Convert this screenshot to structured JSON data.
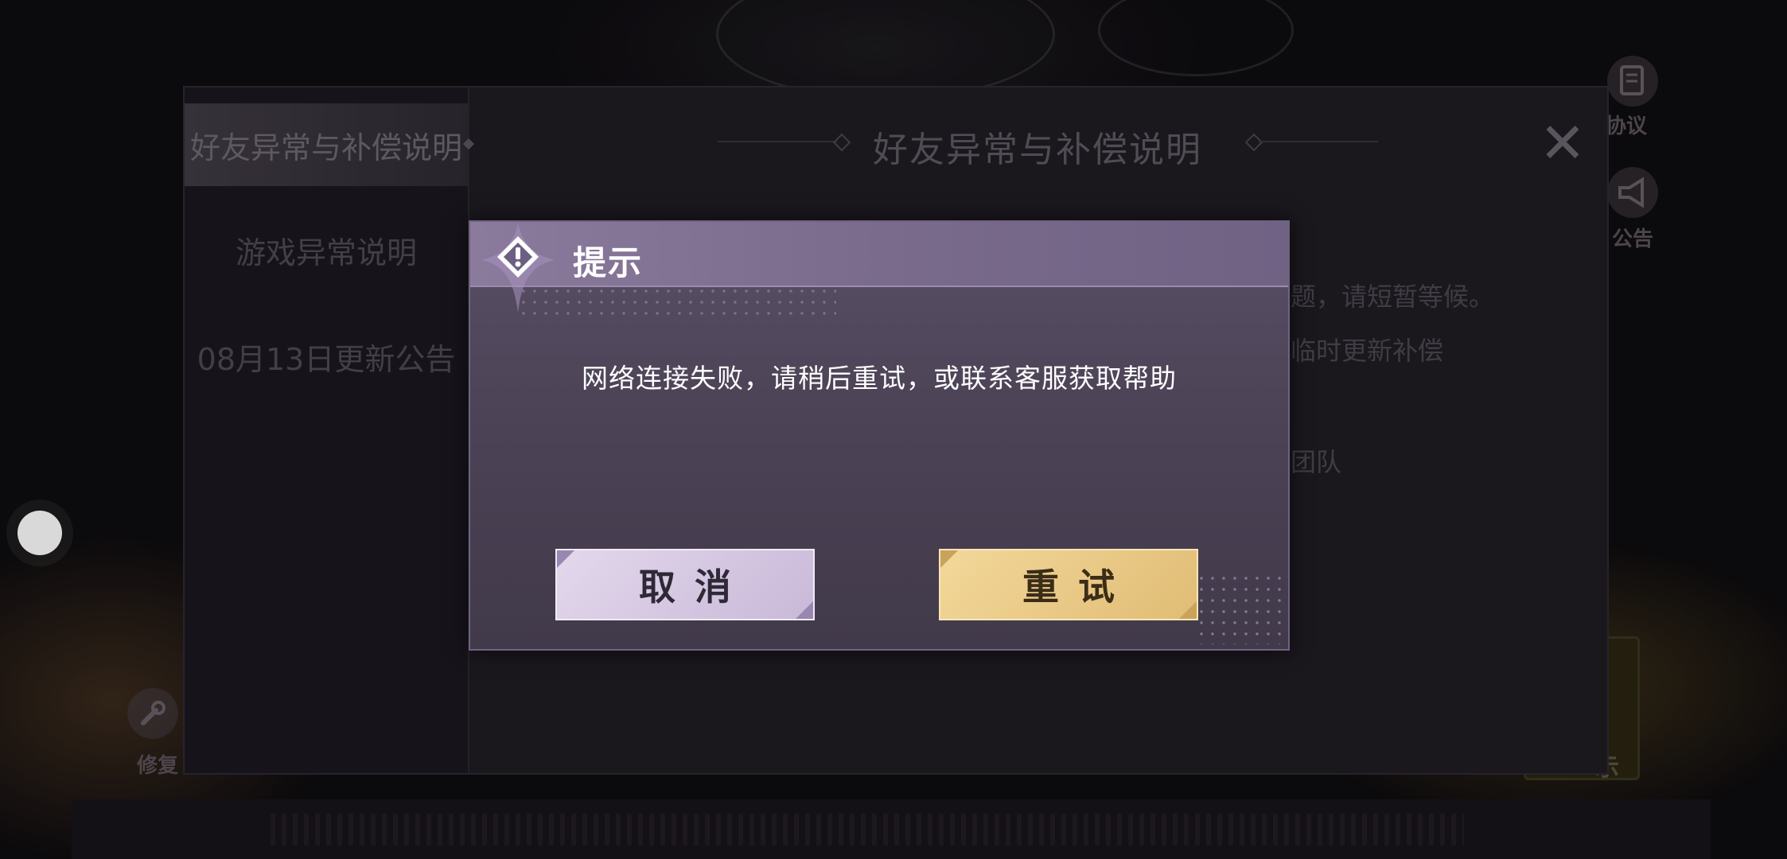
{
  "panel": {
    "title": "好友异常与补偿说明",
    "tabs": [
      {
        "label": "好友异常与补偿说明",
        "active": true
      },
      {
        "label": "游戏异常说明",
        "active": false
      },
      {
        "label": "08月13日更新公告",
        "active": false
      }
    ],
    "content_fragments": [
      "题，请短暂等候。",
      "临时更新补偿",
      "团队"
    ]
  },
  "side_buttons": {
    "agreement_label": "协议",
    "notice_label": "公告",
    "repair_label": "修复",
    "bottom_right_label": "示"
  },
  "dialog": {
    "title": "提示",
    "message": "网络连接失败，请稍后重试，或联系客服获取帮助",
    "cancel_label": "取消",
    "retry_label": "重试"
  },
  "colors": {
    "dialog_header": "#8a7a9c",
    "dialog_body": "#4c4356",
    "cancel_button": "#d8cbe4",
    "retry_button": "#e9c985"
  },
  "icons": {
    "dialog_badge": "warning-diamond-icon",
    "close": "close-icon",
    "agreement": "document-icon",
    "notice": "megaphone-icon",
    "repair": "wrench-icon"
  }
}
